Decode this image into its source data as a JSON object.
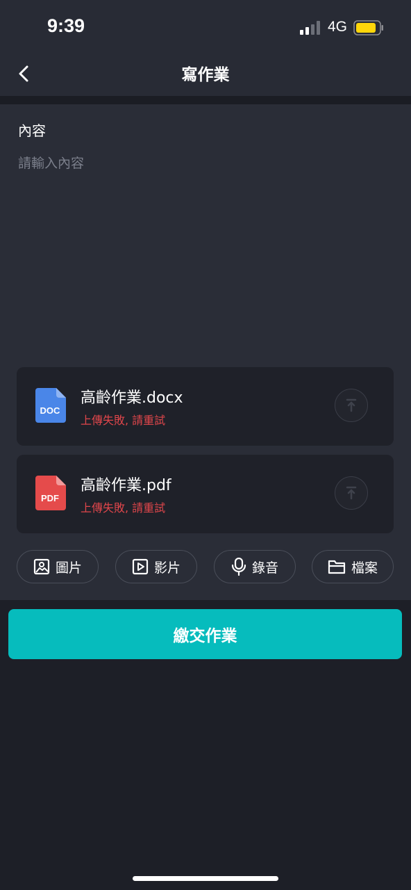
{
  "status_bar": {
    "time": "9:39",
    "network": "4G",
    "battery_color": "#ffd60a"
  },
  "nav": {
    "back_icon": "chevron-left-icon",
    "title": "寫作業"
  },
  "editor": {
    "label": "內容",
    "placeholder": "請輸入內容",
    "value": ""
  },
  "attachments": [
    {
      "type": "DOC",
      "icon_color": "#4a86e8",
      "name": "高齡作業.docx",
      "status": "上傳失敗, 請重試",
      "action_icon": "upload-icon"
    },
    {
      "type": "PDF",
      "icon_color": "#e54b4b",
      "name": "高齡作業.pdf",
      "status": "上傳失敗, 請重試",
      "action_icon": "upload-icon"
    }
  ],
  "attach_buttons": [
    {
      "label": "圖片",
      "icon": "image-icon"
    },
    {
      "label": "影片",
      "icon": "video-icon"
    },
    {
      "label": "錄音",
      "icon": "microphone-icon"
    },
    {
      "label": "檔案",
      "icon": "folder-icon"
    }
  ],
  "submit": {
    "label": "繳交作業",
    "color": "#06bcbd"
  },
  "colors": {
    "error": "#e0464b",
    "background": "#1d1f27",
    "panel": "#2a2d37"
  }
}
